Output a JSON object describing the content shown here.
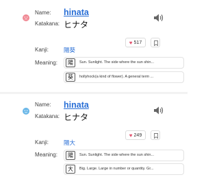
{
  "labels": {
    "name": "Name:",
    "katakana": "Katakana:",
    "kanji": "Kanji:",
    "meaning": "Meaning:"
  },
  "colors": {
    "female": "#f08a95",
    "male": "#6ab7e8",
    "link": "#2a6fd6",
    "heart": "#e25570"
  },
  "entries": [
    {
      "gender_icon": "female-icon",
      "name": "hinata",
      "katakana": "ヒナタ",
      "likes": "517",
      "kanji": "陽葵",
      "meanings": [
        {
          "char": "陽",
          "text": "Sun. Sunlight. The side where the sun shin..."
        },
        {
          "char": "葵",
          "text": "hollyhock(a kind of flower). A general term ..."
        }
      ]
    },
    {
      "gender_icon": "male-icon",
      "name": "hinata",
      "katakana": "ヒナタ",
      "likes": "249",
      "kanji": "陽大",
      "meanings": [
        {
          "char": "陽",
          "text": "Sun. Sunlight. The side where the sun shin..."
        },
        {
          "char": "大",
          "text": "Big. Large. Large in number or quantity. Gr..."
        }
      ]
    }
  ]
}
